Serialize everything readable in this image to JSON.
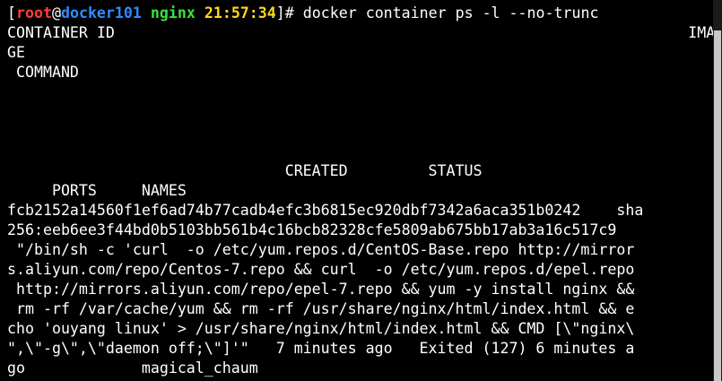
{
  "prompt": {
    "bracket_open": "[",
    "user": "root",
    "at": "@",
    "host": "docker101",
    "space": " ",
    "dir": "nginx",
    "time": "21:57:34",
    "bracket_close": "]# ",
    "command": "docker container ps -l --no-trunc"
  },
  "output_lines": [
    "CONTAINER ID                                                                IMA",
    "GE",
    " COMMAND",
    "",
    "",
    "",
    "",
    "",
    "                               CREATED         STATUS",
    "     PORTS     NAMES",
    "fcb2152a14560f1ef6ad74b77cadb4efc3b6815ec920dbf7342a6aca351b0242    sha",
    "256:eeb6ee3f44bd0b5103bb561b4c16bcb82328cfe5809ab675bb17ab3a16c517c9",
    " \"/bin/sh -c 'curl  -o /etc/yum.repos.d/CentOS-Base.repo http://mirror",
    "s.aliyun.com/repo/Centos-7.repo && curl  -o /etc/yum.repos.d/epel.repo",
    " http://mirrors.aliyun.com/repo/epel-7.repo && yum -y install nginx &&",
    " rm -rf /var/cache/yum && rm -rf /usr/share/nginx/html/index.html && e",
    "cho 'ouyang linux' > /usr/share/nginx/html/index.html && CMD [\\\"nginx\\",
    "\",\\\"-g\\\",\\\"daemon off;\\\"]'\"   7 minutes ago   Exited (127) 6 minutes a",
    "go             magical_chaum"
  ],
  "scrollbar": {
    "visible_fraction": 0.92
  }
}
